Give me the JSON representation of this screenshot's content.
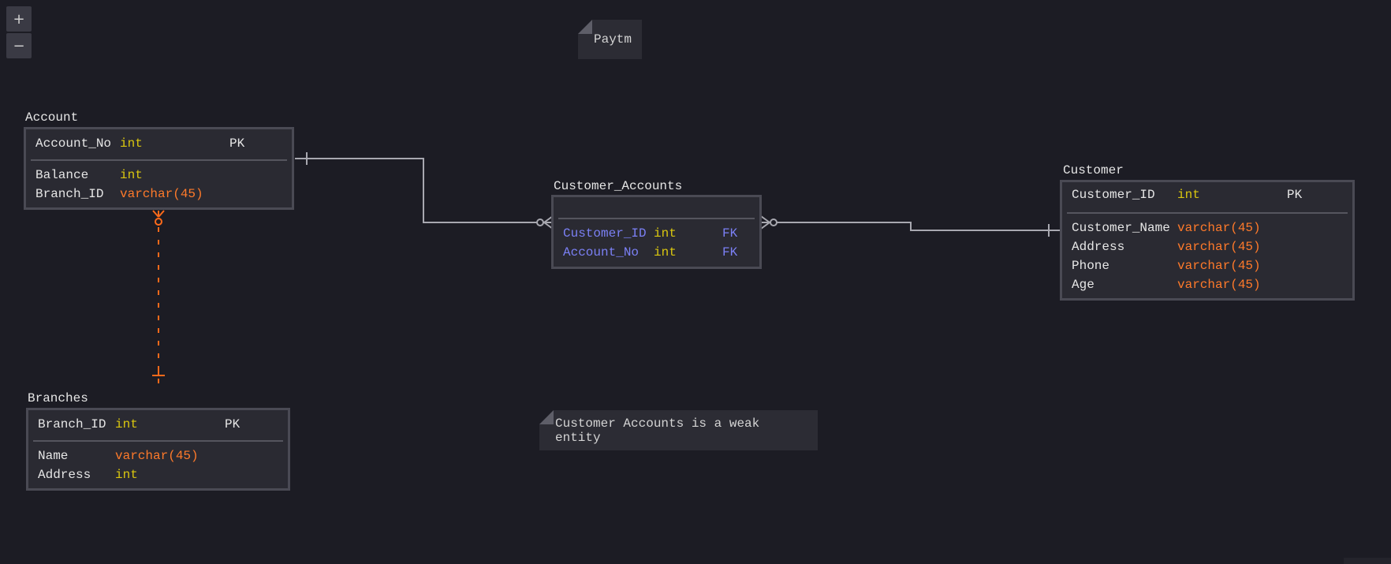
{
  "zoom": {
    "in_label": "+",
    "out_label": "−"
  },
  "notes": {
    "paytm": "Paytm",
    "weak_entity": "Customer Accounts is a weak entity"
  },
  "colors": {
    "background": "#1c1c24",
    "int_type": "#d9c60f",
    "varchar_type": "#ff7a2a",
    "foreign_key": "#7b80f5",
    "dashed_relation": "#ff6a1a",
    "solid_relation": "#a8a8b0"
  },
  "tables": {
    "account": {
      "title": "Account",
      "key_rows": [
        {
          "name": "Account_No",
          "type": "int",
          "key": "PK"
        }
      ],
      "rows": [
        {
          "name": "Balance",
          "type": "int",
          "key": ""
        },
        {
          "name": "Branch_ID",
          "type": "varchar(45)",
          "key": ""
        }
      ]
    },
    "customer_accounts": {
      "title": "Customer_Accounts",
      "key_rows": [],
      "rows": [
        {
          "name": "Customer_ID",
          "type": "int",
          "key": "FK"
        },
        {
          "name": "Account_No",
          "type": "int",
          "key": "FK"
        }
      ]
    },
    "customer": {
      "title": "Customer",
      "key_rows": [
        {
          "name": "Customer_ID",
          "type": "int",
          "key": "PK"
        }
      ],
      "rows": [
        {
          "name": "Customer_Name",
          "type": "varchar(45)",
          "key": ""
        },
        {
          "name": "Address",
          "type": "varchar(45)",
          "key": ""
        },
        {
          "name": "Phone",
          "type": "varchar(45)",
          "key": ""
        },
        {
          "name": "Age",
          "type": "varchar(45)",
          "key": ""
        }
      ]
    },
    "branches": {
      "title": "Branches",
      "key_rows": [
        {
          "name": "Branch_ID",
          "type": "int",
          "key": "PK"
        }
      ],
      "rows": [
        {
          "name": "Name",
          "type": "varchar(45)",
          "key": ""
        },
        {
          "name": "Address",
          "type": "int",
          "key": ""
        }
      ]
    }
  }
}
